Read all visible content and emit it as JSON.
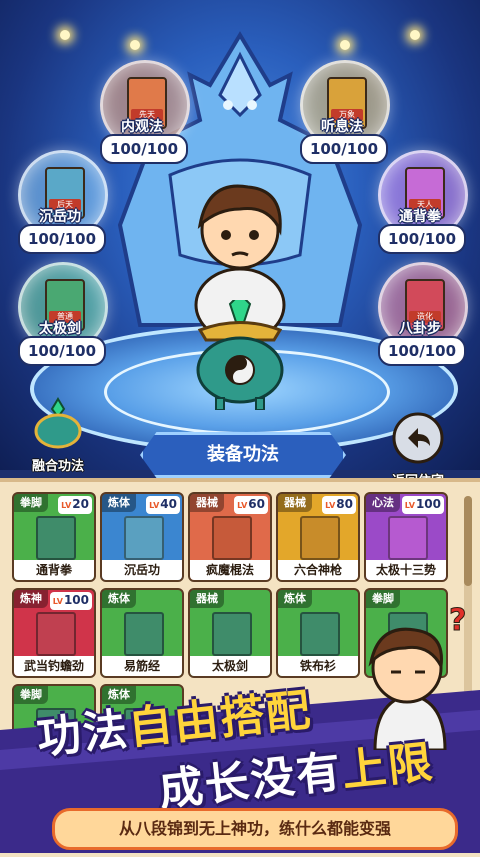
{
  "colors": {
    "accent": "#ffd43b",
    "bg_dark": "#1c2f6e",
    "panel": "#f4e3c2"
  },
  "slots": [
    {
      "type": "先天",
      "name": "内观法",
      "count": "100/100",
      "book_color": "#e07a4a"
    },
    {
      "type": "万象",
      "name": "听息法",
      "count": "100/100",
      "book_color": "#d9a23a"
    },
    {
      "type": "后天",
      "name": "沉岳功",
      "count": "100/100",
      "book_color": "#5aa8c8"
    },
    {
      "type": "天人",
      "name": "通背拳",
      "count": "100/100",
      "book_color": "#c66bd6"
    },
    {
      "type": "普通",
      "name": "太极剑",
      "count": "100/100",
      "book_color": "#4aa872"
    },
    {
      "type": "造化",
      "name": "八卦步",
      "count": "100/100",
      "book_color": "#d24a5a"
    }
  ],
  "buttons": {
    "fuse": "融合功法",
    "equip": "装备功法",
    "return": "返回住宅"
  },
  "cards": [
    {
      "cat": "拳脚",
      "lv": "20",
      "name": "通背拳",
      "bg": "#4bb04a",
      "book": "#3f8c6a",
      "tag": "普通"
    },
    {
      "cat": "炼体",
      "lv": "40",
      "name": "沉岳功",
      "bg": "#3b86d0",
      "book": "#5aa0c0",
      "tag": "后天"
    },
    {
      "cat": "器械",
      "lv": "60",
      "name": "疯魔棍法",
      "bg": "#e06a4a",
      "book": "#c65a3a",
      "tag": "先天"
    },
    {
      "cat": "器械",
      "lv": "80",
      "name": "六合神枪",
      "bg": "#e3a72a",
      "book": "#c88c2a",
      "tag": "万象"
    },
    {
      "cat": "心法",
      "lv": "100",
      "name": "太极十三势",
      "bg": "#9b4ac8",
      "book": "#b65ad0",
      "tag": "天人"
    },
    {
      "cat": "炼神",
      "lv": "100",
      "name": "武当钓蟾劲",
      "bg": "#d0344a",
      "book": "#c04050",
      "tag": "造化"
    },
    {
      "cat": "炼体",
      "lv": "",
      "name": "易筋经",
      "bg": "#4bb04a",
      "book": "#3f8c6a",
      "tag": ""
    },
    {
      "cat": "器械",
      "lv": "",
      "name": "太极剑",
      "bg": "#4bb04a",
      "book": "#3f8c6a",
      "tag": "普通"
    },
    {
      "cat": "炼体",
      "lv": "",
      "name": "铁布衫",
      "bg": "#4bb04a",
      "book": "#3f8c6a",
      "tag": "普通"
    },
    {
      "cat": "拳脚",
      "lv": "",
      "name": "",
      "bg": "#4bb04a",
      "book": "#3f8c6a",
      "tag": ""
    },
    {
      "cat": "拳脚",
      "lv": "",
      "name": "",
      "bg": "#4bb04a",
      "book": "#3f8c6a",
      "tag": ""
    },
    {
      "cat": "炼体",
      "lv": "",
      "name": "",
      "bg": "#4bb04a",
      "book": "#3f8c6a",
      "tag": ""
    }
  ],
  "lv_prefix": "LV",
  "slogan": {
    "line1_a": "功法",
    "line1_b": "自由搭配",
    "line2_a": "成长没有",
    "line2_b": "上限",
    "tagline": "从八段锦到无上神功，练什么都能变强"
  }
}
